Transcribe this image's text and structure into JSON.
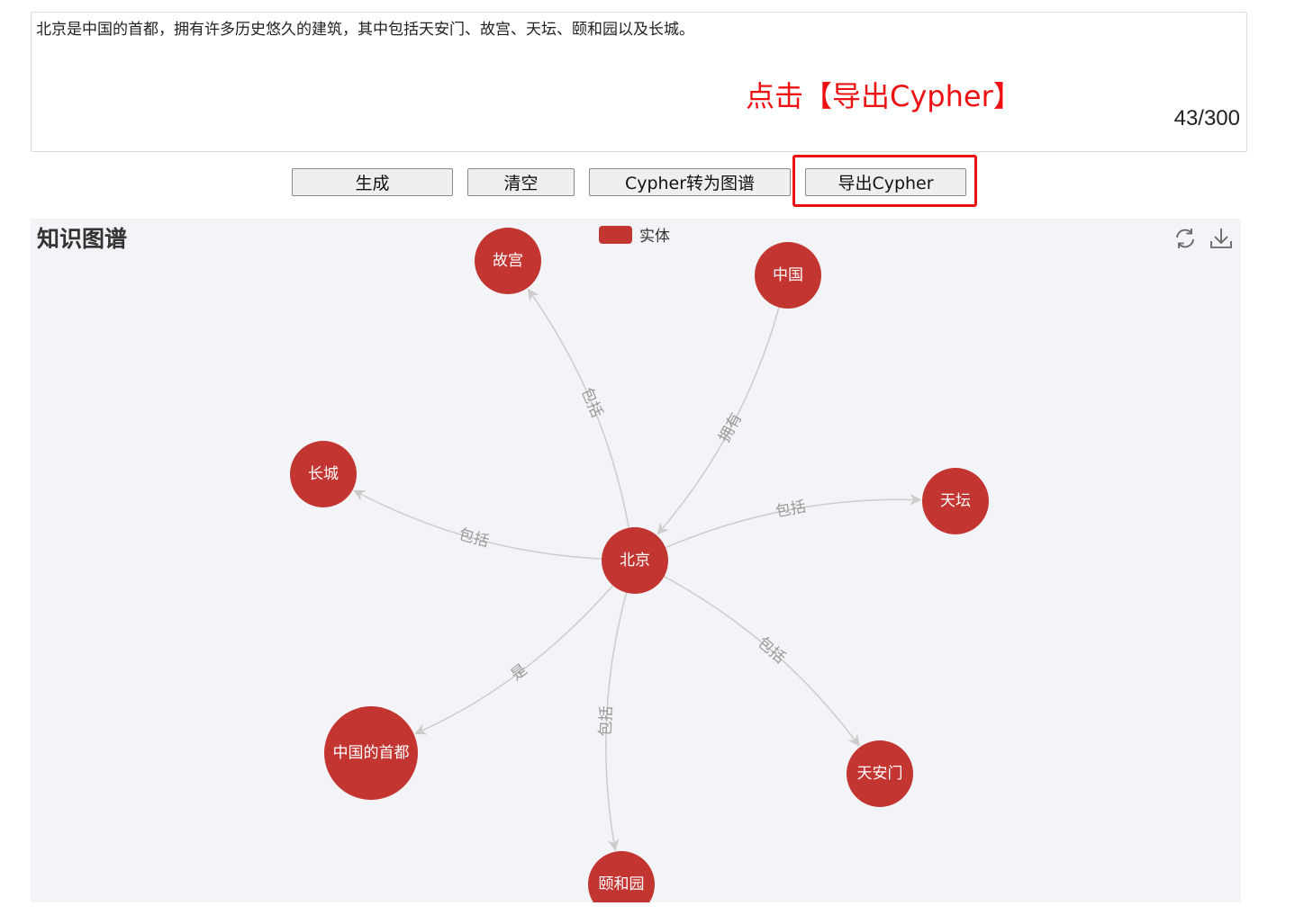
{
  "input": {
    "text": "北京是中国的首都，拥有许多历史悠久的建筑，其中包括天安门、故宫、天坛、颐和园以及长城。",
    "char_count": "43/300"
  },
  "annotation": {
    "text": "点击【导出Cypher】",
    "color": "#ee1111"
  },
  "buttons": {
    "generate": "生成",
    "clear": "清空",
    "cypher_to_graph": "Cypher转为图谱",
    "export_cypher": "导出Cypher"
  },
  "graph": {
    "title": "知识图谱",
    "legend": {
      "label": "实体",
      "color": "#c23531"
    },
    "toolbar": {
      "refresh_icon": "refresh-icon",
      "download_icon": "download-icon"
    },
    "node_color": "#c23531",
    "edge_color": "#cccccc",
    "nodes": [
      {
        "id": "beijing",
        "label": "北京"
      },
      {
        "id": "gugong",
        "label": "故宫"
      },
      {
        "id": "zhongguo",
        "label": "中国"
      },
      {
        "id": "changcheng",
        "label": "长城"
      },
      {
        "id": "tiantan",
        "label": "天坛"
      },
      {
        "id": "shoudu",
        "label": "中国的首都"
      },
      {
        "id": "tiananmen",
        "label": "天安门"
      },
      {
        "id": "yiheyuan",
        "label": "颐和园"
      }
    ],
    "edges": [
      {
        "source": "beijing",
        "target": "gugong",
        "label": "包括"
      },
      {
        "source": "zhongguo",
        "target": "beijing",
        "label": "拥有"
      },
      {
        "source": "beijing",
        "target": "changcheng",
        "label": "包括"
      },
      {
        "source": "beijing",
        "target": "tiantan",
        "label": "包括"
      },
      {
        "source": "beijing",
        "target": "shoudu",
        "label": "是"
      },
      {
        "source": "beijing",
        "target": "tiananmen",
        "label": "包括"
      },
      {
        "source": "beijing",
        "target": "yiheyuan",
        "label": "包括"
      }
    ]
  }
}
